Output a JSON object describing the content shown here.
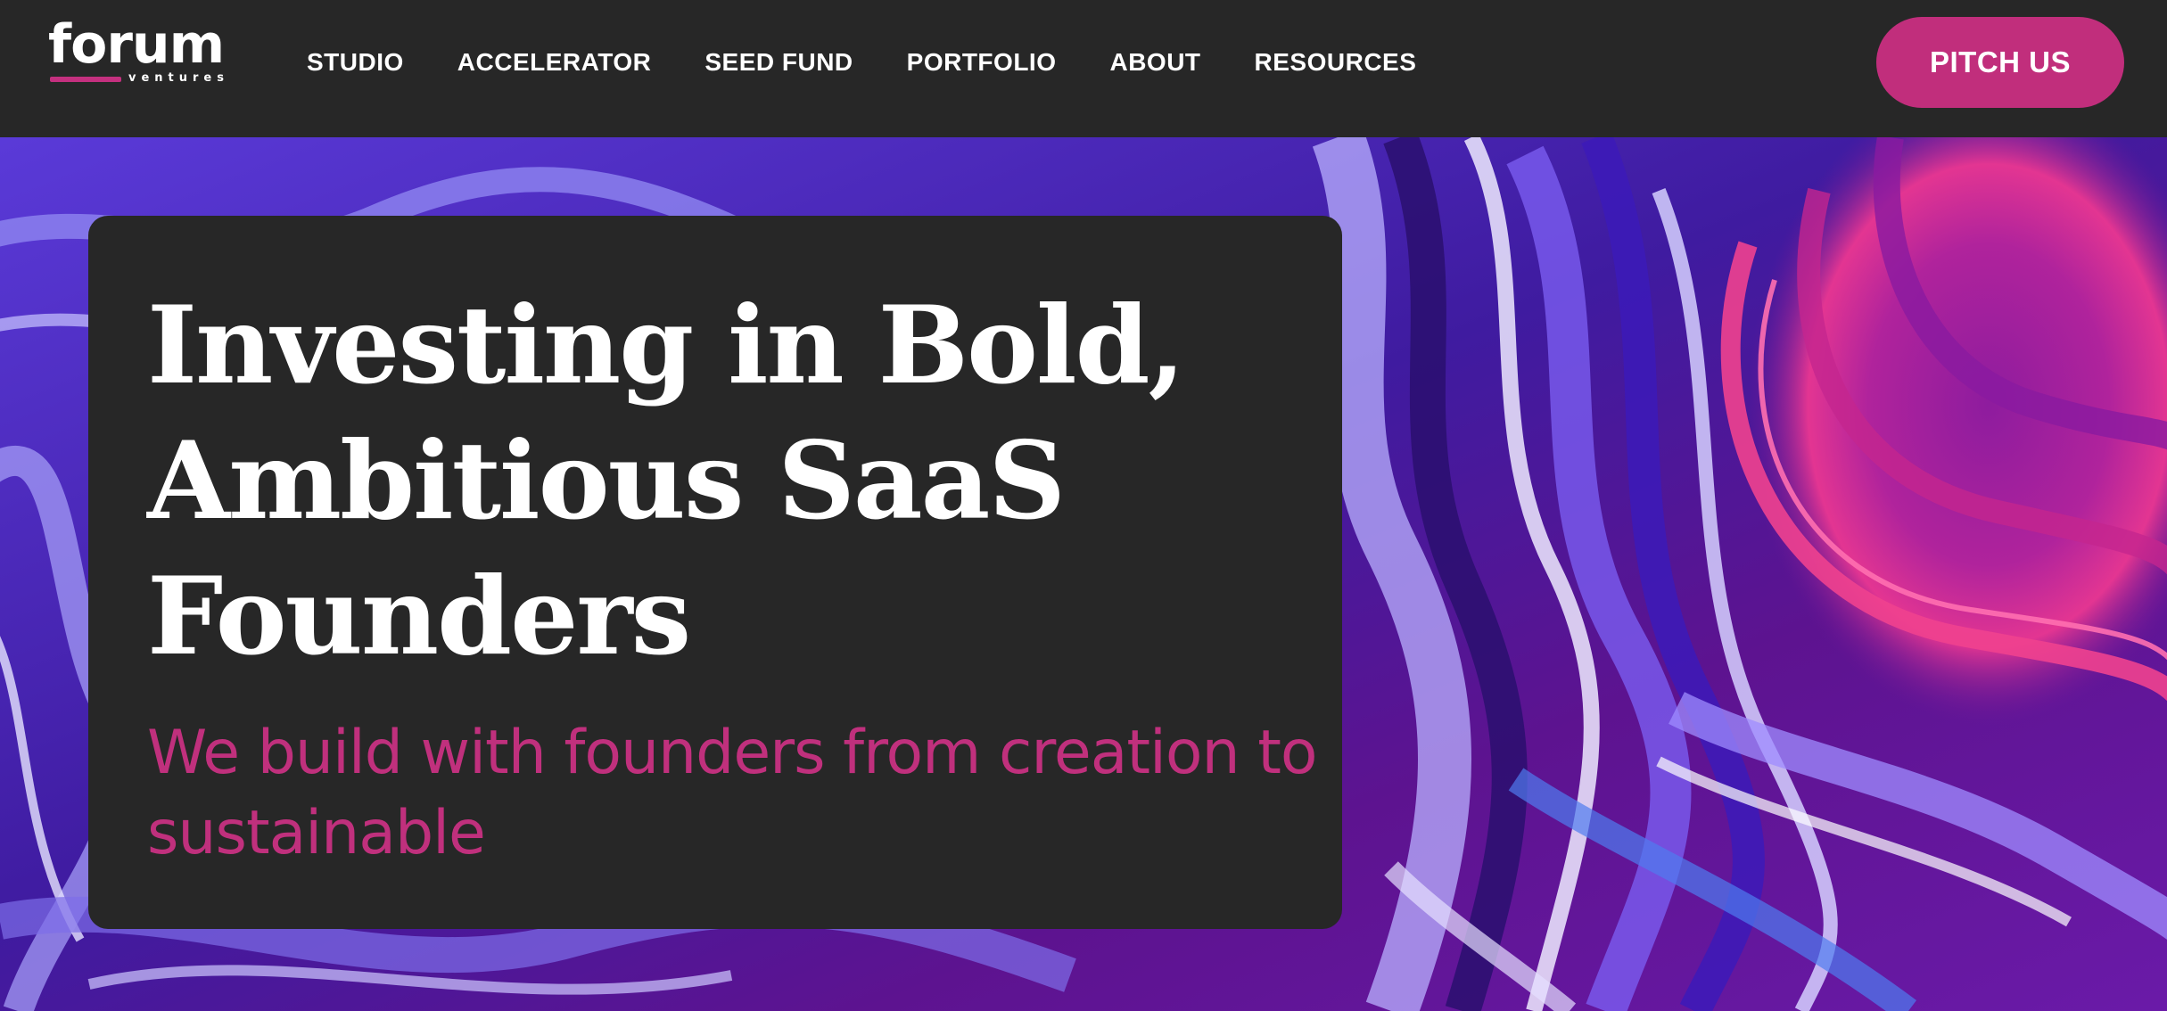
{
  "header": {
    "logo": {
      "wordmark": "forum",
      "subtext": "ventures",
      "icon": "forum-ventures-logo"
    },
    "nav": [
      {
        "label": "STUDIO"
      },
      {
        "label": "ACCELERATOR"
      },
      {
        "label": "SEED FUND"
      },
      {
        "label": "PORTFOLIO"
      },
      {
        "label": "ABOUT"
      },
      {
        "label": "RESOURCES"
      }
    ],
    "cta_label": "PITCH US"
  },
  "hero": {
    "title": "Investing in Bold, Ambitious SaaS Founders",
    "subtitle": "We build with founders from creation to sustainable",
    "background": "purple-fluid-art-image"
  },
  "colors": {
    "background": "#272727",
    "brand_magenta": "#c12e7c",
    "text_white": "#ffffff",
    "art_purple": "#5b2fd0",
    "art_pink": "#e0308f"
  }
}
